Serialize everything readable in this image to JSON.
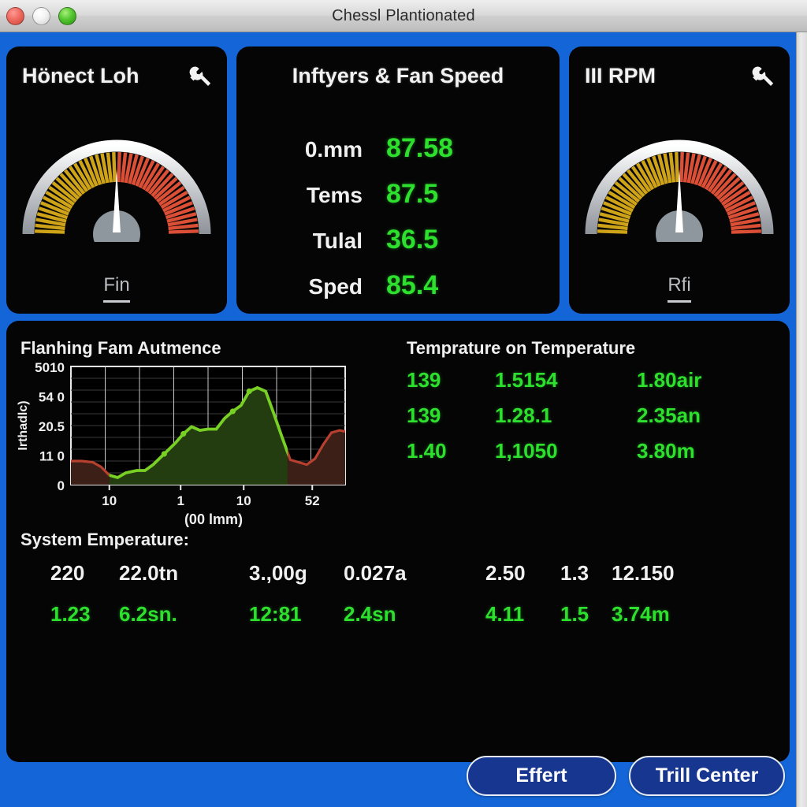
{
  "window": {
    "title": "Chessl Plantionated",
    "traffic_lights": [
      "close-button",
      "minimize-button",
      "zoom-button"
    ],
    "background_color": "#1466d8",
    "panel_color": "#050505",
    "accent_green": "#2ee02e"
  },
  "panels": {
    "left_gauge": {
      "title": "Hönect Loh",
      "icon": "wrench-icon",
      "footer_label": "Fin",
      "needle_angle_deg": 0
    },
    "center": {
      "title": "Inftyers & Fan Speed",
      "rows": [
        {
          "label": "0.mm",
          "value": "87.58"
        },
        {
          "label": "Tems",
          "value": "87.5"
        },
        {
          "label": "Tulal",
          "value": "36.5"
        },
        {
          "label": "Sped",
          "value": "85.4"
        }
      ]
    },
    "right_gauge": {
      "title": "III RPM",
      "icon": "wrench-icon",
      "footer_label": "Rfi",
      "needle_angle_deg": 0
    }
  },
  "bottom": {
    "chart_title": "Flanhing Fam Autmence",
    "temp_title": "Temprature on Temperature",
    "temp_grid": [
      [
        "139",
        "1.5154",
        "1.80air"
      ],
      [
        "139",
        "1.28.1",
        "2.35an"
      ],
      [
        "1.40",
        "1,1050",
        "3.80m"
      ]
    ],
    "system_title": "System Emperature:",
    "system_rows": {
      "white": [
        "220",
        "22.0tn",
        "3.,00g",
        "0.027a",
        "2.50",
        "1.3",
        "12.150"
      ],
      "green": [
        "1.23",
        "6.2sn.",
        "12:81",
        "2.4sn",
        "4.11",
        "1.5",
        "3.74m"
      ]
    }
  },
  "footer": {
    "buttons": [
      {
        "label": "Effert",
        "name": "effert-button"
      },
      {
        "label": "Trill Center",
        "name": "trill-center-button"
      }
    ]
  },
  "chart_data": {
    "type": "area",
    "title": "Flanhing Fam Autmence",
    "xlabel": "(00 lmm)",
    "ylabel": "Irthadlc)",
    "ytick_labels": [
      "5010",
      "54 0",
      "20.5",
      "11 0",
      "0"
    ],
    "xtick_labels": [
      "10",
      "1",
      "10",
      "52"
    ],
    "grid": true,
    "legend": "none",
    "ylim": [
      0,
      10
    ],
    "xlim": [
      0,
      100
    ],
    "series": [
      {
        "name": "signal",
        "x": [
          0,
          4,
          8,
          11,
          14,
          17,
          20,
          24,
          27,
          30,
          34,
          38,
          41,
          44,
          47,
          50,
          53,
          56,
          59,
          62,
          65,
          68,
          71,
          74,
          77,
          80,
          83,
          86,
          89,
          92,
          95,
          98,
          100
        ],
        "y": [
          2.0,
          2.0,
          1.9,
          1.5,
          0.8,
          0.6,
          1.0,
          1.2,
          1.2,
          1.7,
          2.6,
          3.5,
          4.3,
          4.9,
          4.6,
          4.7,
          4.7,
          5.6,
          6.2,
          6.7,
          7.9,
          8.2,
          7.9,
          6.0,
          4.0,
          2.1,
          1.9,
          1.7,
          2.2,
          3.4,
          4.4,
          4.6,
          4.5
        ],
        "color_low": "#b8402f",
        "color_high": "#79d024"
      }
    ],
    "highlight_region_x": [
      14,
      79
    ],
    "highlight_color": "#79d024",
    "base_color": "#b8402f"
  }
}
